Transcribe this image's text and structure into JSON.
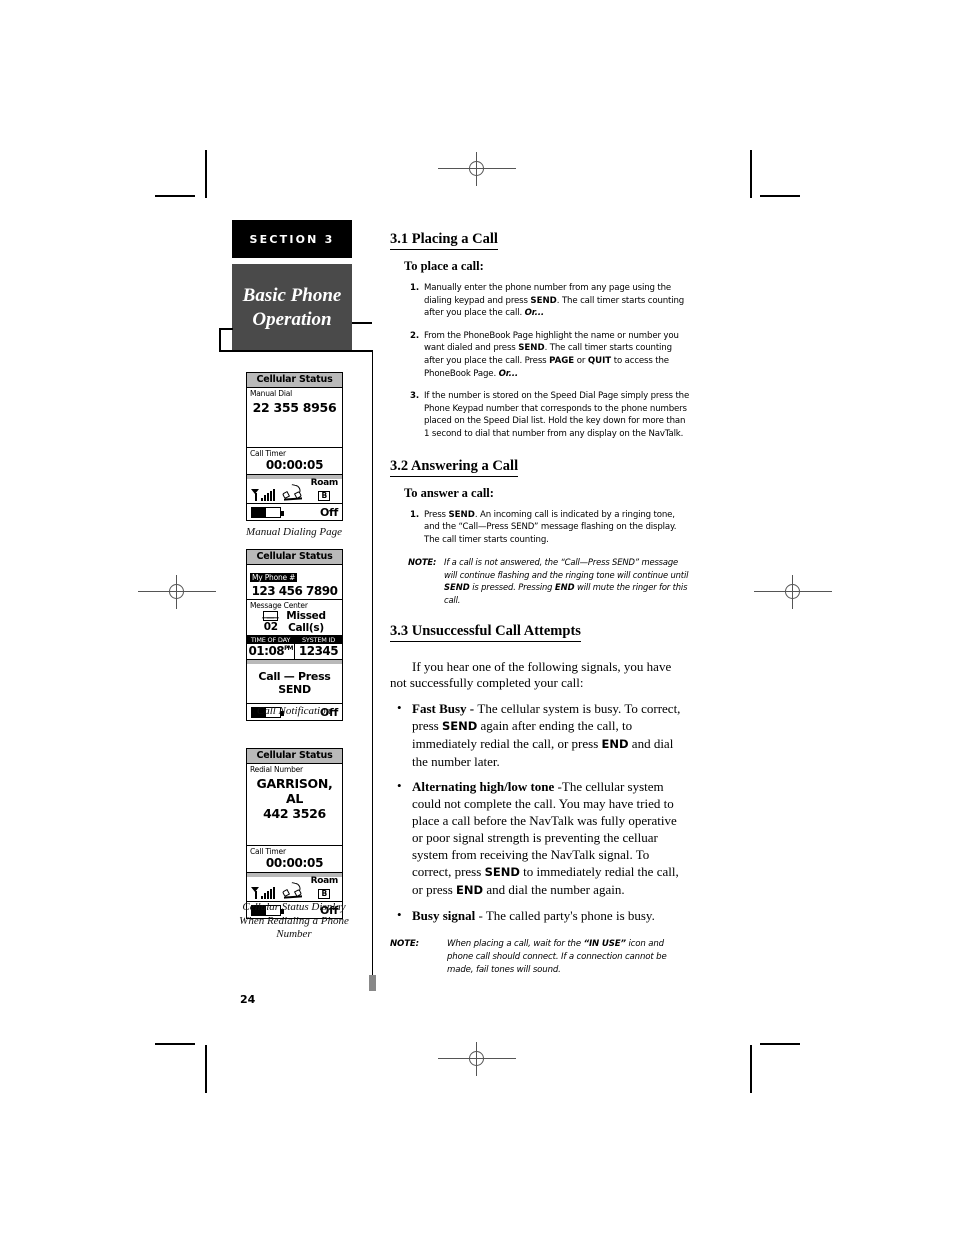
{
  "page": {
    "number": "24"
  },
  "sidebar": {
    "section_tag": "SECTION 3",
    "title_line1": "Basic Phone",
    "title_line2": "Operation",
    "displays": [
      {
        "name": "manual-dialing",
        "title": "Cellular Status",
        "label": "Manual Dial",
        "number": "22 355 8956",
        "timer_label": "Call Timer",
        "timer_value": "00:00:05",
        "roam_text": "Roam",
        "roam_band": "B",
        "power_state": "Off",
        "caption": "Manual Dialing Page"
      },
      {
        "name": "call-notification",
        "title": "Cellular Status",
        "label": "My Phone #",
        "number": "123 456 7890",
        "message_center_label": "Message Center",
        "missed_count": "02",
        "missed_text_line1": "Missed",
        "missed_text_line2": "Call(s)",
        "time_of_day_label": "TIME OF DAY",
        "time_of_day_value": "01:08",
        "time_of_day_suffix": "PM",
        "system_id_label": "SYSTEM ID",
        "system_id_value": "12345",
        "call_banner": "Call — Press SEND",
        "power_state": "Off",
        "caption": "Call Notification"
      },
      {
        "name": "redial-status",
        "title": "Cellular Status",
        "label": "Redial Number",
        "name_line": "GARRISON, AL",
        "number": "442 3526",
        "timer_label": "Call Timer",
        "timer_value": "00:00:05",
        "roam_text": "Roam",
        "roam_band": "B",
        "power_state": "Off",
        "caption_line1": "Cellular Status Display",
        "caption_line2": "When Redialing a Phone",
        "caption_line3": "Number"
      }
    ]
  },
  "main": {
    "sections": [
      {
        "heading": "3.1  Placing a Call",
        "subheading": "To place a call:",
        "steps": [
          {
            "num": "1.",
            "parts": [
              {
                "t": "Manually enter the phone number from any page using the dialing keypad and press ",
                "s": "n"
              },
              {
                "t": "SEND",
                "s": "k"
              },
              {
                "t": ". The call timer starts counting after you place the call. ",
                "s": "n"
              },
              {
                "t": "Or...",
                "s": "i"
              }
            ]
          },
          {
            "num": "2.",
            "parts": [
              {
                "t": "From the PhoneBook Page highlight the name or number you want dialed and press ",
                "s": "n"
              },
              {
                "t": "SEND",
                "s": "k"
              },
              {
                "t": ". The call timer starts counting after you place the call. Press ",
                "s": "n"
              },
              {
                "t": "PAGE",
                "s": "k"
              },
              {
                "t": "  or ",
                "s": "n"
              },
              {
                "t": "QUIT",
                "s": "k"
              },
              {
                "t": " to access the PhoneBook Page. ",
                "s": "n"
              },
              {
                "t": "Or...",
                "s": "i"
              }
            ]
          },
          {
            "num": "3.",
            "parts": [
              {
                "t": "If the number is stored on the Speed Dial Page simply press the Phone Keypad number that corresponds to the phone numbers placed on the Speed Dial list. Hold the key down for more than 1 second to dial that number from any display on the NavTalk.",
                "s": "n"
              }
            ]
          }
        ]
      },
      {
        "heading": "3.2  Answering a Call",
        "subheading": "To answer a call:",
        "steps": [
          {
            "num": "1.",
            "parts": [
              {
                "t": "Press ",
                "s": "n"
              },
              {
                "t": "SEND",
                "s": "k"
              },
              {
                "t": ". An incoming call is indicated by a ringing tone, and the “Call—Press SEND” message flashing on the display. The call timer starts counting.",
                "s": "n"
              }
            ]
          }
        ],
        "note": {
          "label": "NOTE:",
          "parts": [
            {
              "t": "If a call is not answered, the “Call—Press SEND” message will continue flashing and the ringing tone will continue until ",
              "s": "n"
            },
            {
              "t": "SEND",
              "s": "k"
            },
            {
              "t": " is pressed. Pressing ",
              "s": "n"
            },
            {
              "t": "END",
              "s": "k"
            },
            {
              "t": " will mute the ringer for this call.",
              "s": "n"
            }
          ]
        }
      },
      {
        "heading": "3.3   Unsuccessful Call Attempts",
        "intro": "If you hear one of the following signals, you have not successfully completed your call:",
        "bullets": [
          {
            "term": "Fast Busy - ",
            "parts": [
              {
                "t": "The cellular system is busy. To correct, press ",
                "s": "n"
              },
              {
                "t": "SEND",
                "s": "k"
              },
              {
                "t": " again after ending the call, to immediately redial the call, or press ",
                "s": "n"
              },
              {
                "t": "END",
                "s": "k"
              },
              {
                "t": " and dial the number later.",
                "s": "n"
              }
            ]
          },
          {
            "term": "Alternating high/low tone ",
            "parts": [
              {
                "t": "-The cellular system could not complete the call. You may have tried to place a call before the NavTalk was fully operative or poor signal strength is preventing the celluar system from receiving the NavTalk signal. To correct, press ",
                "s": "n"
              },
              {
                "t": "SEND",
                "s": "k"
              },
              {
                "t": " to immediately redial the call, or press ",
                "s": "n"
              },
              {
                "t": "END",
                "s": "k"
              },
              {
                "t": " and dial the number again.",
                "s": "n"
              }
            ]
          },
          {
            "term": "Busy signal ",
            "parts": [
              {
                "t": "- The called party's phone is busy.",
                "s": "n"
              }
            ]
          }
        ],
        "note_final": {
          "label": "NOTE:",
          "line1_parts": [
            {
              "t": "When placing a call, wait for the ",
              "s": "n"
            },
            {
              "t": "“IN USE”",
              "s": "b"
            },
            {
              "t": "  icon",
              "s": "n"
            }
          ],
          "rest": "and phone call should connect.  If a connection cannot be made, fail tones will sound."
        }
      }
    ]
  }
}
